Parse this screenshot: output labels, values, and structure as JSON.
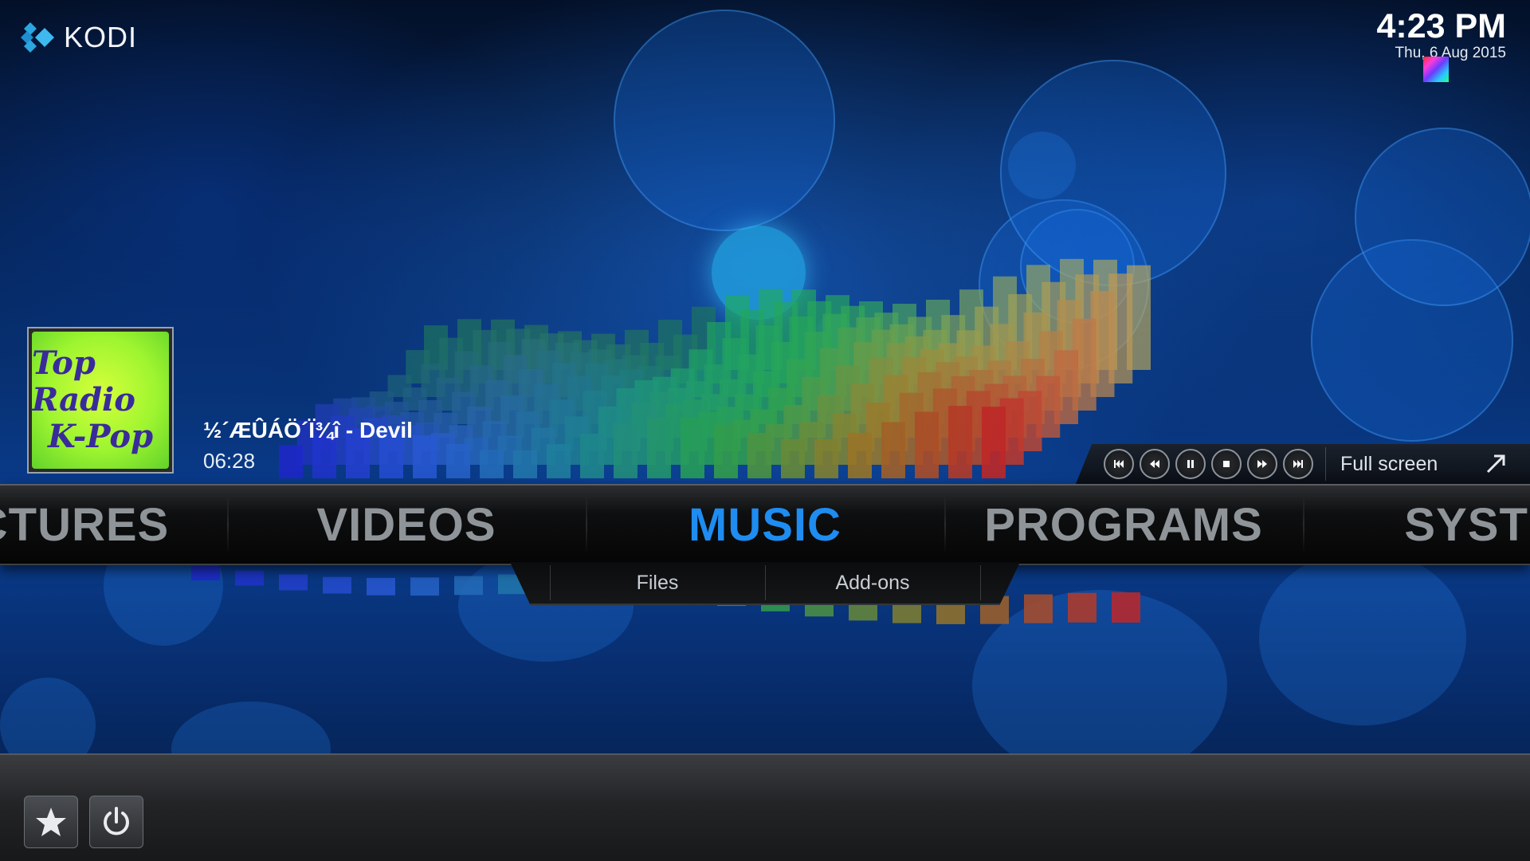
{
  "app": {
    "name": "KODI"
  },
  "header": {
    "time": "4:23 PM",
    "date": "Thu, 6 Aug 2015"
  },
  "now_playing": {
    "album_art_text": [
      "Top Radio",
      "K-Pop"
    ],
    "title": "½´ÆÛÁÖ´Ï¾î - Devil",
    "elapsed": "06:28"
  },
  "playback": {
    "buttons": [
      {
        "icon": "skip-previous-icon"
      },
      {
        "icon": "rewind-icon"
      },
      {
        "icon": "pause-icon"
      },
      {
        "icon": "stop-icon"
      },
      {
        "icon": "fast-forward-icon"
      },
      {
        "icon": "skip-next-icon"
      }
    ],
    "fullscreen_label": "Full screen"
  },
  "main_menu": {
    "items": [
      "CTURES",
      "VIDEOS",
      "MUSIC",
      "PROGRAMS",
      "SYSTE"
    ],
    "active": "MUSIC"
  },
  "submenu": {
    "items": [
      "Files",
      "Add-ons"
    ]
  },
  "bottom_bar": {
    "buttons": [
      "favourites-icon",
      "power-icon"
    ]
  },
  "colors": {
    "accent": "#1e8cf0",
    "menu_inactive": "#8f9499"
  }
}
